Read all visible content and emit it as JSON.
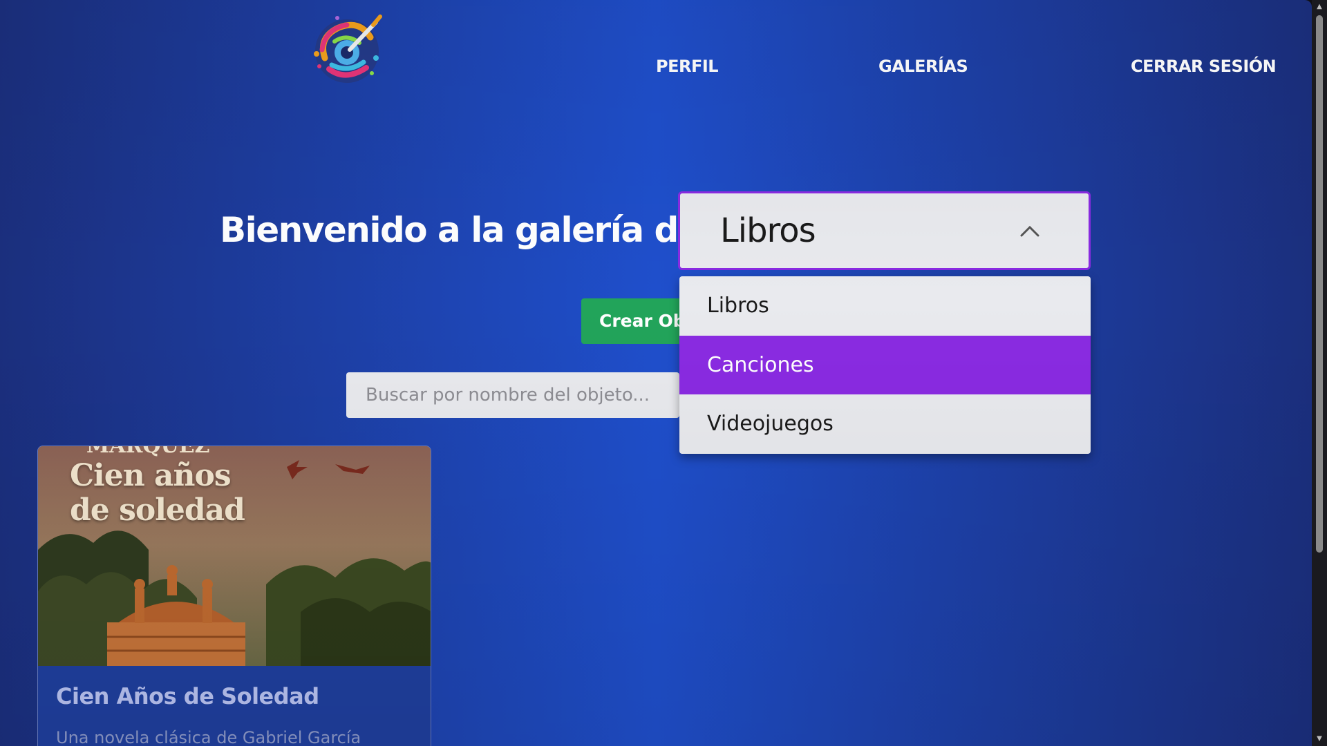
{
  "nav": {
    "logo": "palette-brush-icon",
    "links": [
      "PERFIL",
      "GALERÍAS",
      "CERRAR SESIÓN"
    ]
  },
  "main": {
    "welcome": "Bienvenido a la galería de",
    "gallery_select": {
      "value": "Libros",
      "options": [
        "Libros",
        "Canciones",
        "Videojuegos"
      ],
      "highlighted": "Canciones"
    },
    "create_button": "Crear Ob",
    "search": {
      "placeholder": "Buscar por nombre del objeto...",
      "value": ""
    }
  },
  "cards": [
    {
      "cover_text_top": "MARQUEZ",
      "cover_text": [
        "Cien años",
        "de soledad"
      ],
      "title": "Cien Años de Soledad",
      "description": "Una novela clásica de Gabriel García"
    }
  ],
  "colors": {
    "accent": "#8a2be2",
    "create_button": "#22a45a",
    "background": "#1f4fcc"
  }
}
